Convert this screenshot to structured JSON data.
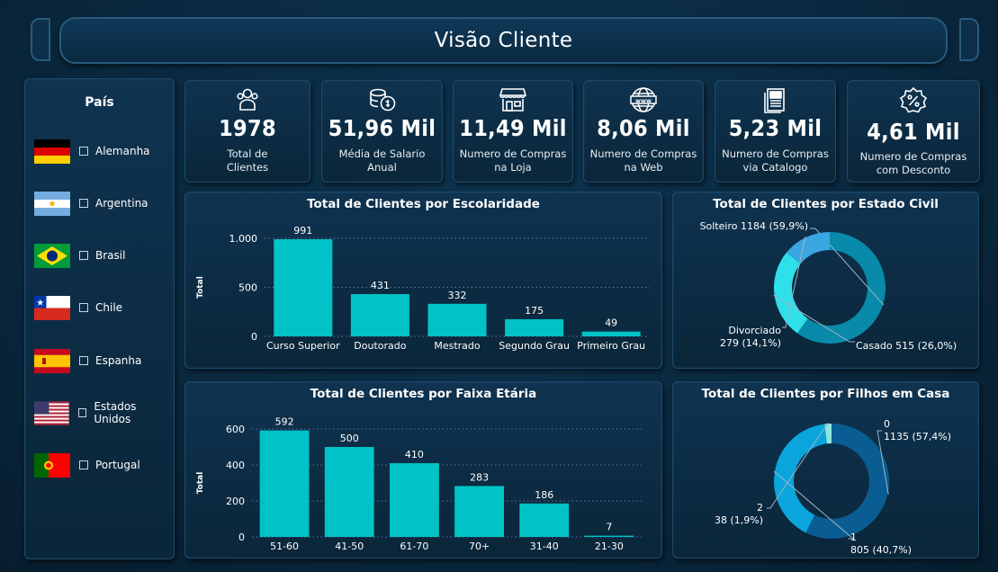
{
  "page": {
    "title": "Visão Cliente"
  },
  "country_filter": {
    "heading": "País",
    "items": [
      {
        "label": "Alemanha",
        "flag": "germany-flag"
      },
      {
        "label": "Argentina",
        "flag": "argentina-flag"
      },
      {
        "label": "Brasil",
        "flag": "brazil-flag"
      },
      {
        "label": "Chile",
        "flag": "chile-flag"
      },
      {
        "label": "Espanha",
        "flag": "spain-flag"
      },
      {
        "label": "Estados Unidos",
        "flag": "usa-flag"
      },
      {
        "label": "Portugal",
        "flag": "portugal-flag"
      }
    ]
  },
  "kpis": [
    {
      "value": "1978",
      "label_lines": [
        "Total de",
        "Clientes"
      ],
      "icon": "people-icon"
    },
    {
      "value": "51,96 Mil",
      "label_lines": [
        "Média de Salario",
        "Anual"
      ],
      "icon": "coins-icon"
    },
    {
      "value": "11,49 Mil",
      "label_lines": [
        "Numero de Compras",
        "na Loja"
      ],
      "icon": "store-icon"
    },
    {
      "value": "8,06 Mil",
      "label_lines": [
        "Numero de Compras",
        "na Web"
      ],
      "icon": "www-globe-icon"
    },
    {
      "value": "5,23 Mil",
      "label_lines": [
        "Numero de Compras",
        "via Catalogo"
      ],
      "icon": "catalog-icon"
    },
    {
      "value": "4,61 Mil",
      "label_lines": [
        "Numero de Compras",
        "com Desconto"
      ],
      "icon": "discount-badge-icon"
    }
  ],
  "colors": {
    "bar": "#00c2c7",
    "background": "#0a2940",
    "panel_border": "#1d4a6b",
    "grid": "#5b7a90"
  },
  "chart_data": [
    {
      "type": "bar",
      "title": "Total de Clientes por Escolaridade",
      "xlabel": "",
      "ylabel": "Total",
      "categories": [
        "Curso Superior",
        "Doutorado",
        "Mestrado",
        "Segundo Grau",
        "Primeiro Grau"
      ],
      "values": [
        991,
        431,
        332,
        175,
        49
      ],
      "yticks": [
        0,
        500,
        1000
      ],
      "ytick_labels": [
        "0",
        "500",
        "1.000"
      ],
      "ylim": [
        0,
        1000
      ],
      "grid": true,
      "color": "#00c2c7"
    },
    {
      "type": "pie",
      "title": "Total de Clientes por Estado Civil",
      "donut": true,
      "slices": [
        {
          "label": "Solteiro",
          "value": 1184,
          "percent": "59,9%",
          "color": "#0a8aaa",
          "text_lines": [
            "Solteiro 1184 (59,9%)"
          ]
        },
        {
          "label": "Casado",
          "value": 515,
          "percent": "26,0%",
          "color": "#2fe0ea",
          "text_lines": [
            "Casado 515 (26,0%)"
          ]
        },
        {
          "label": "Divorciado",
          "value": 279,
          "percent": "14,1%",
          "color": "#3aa6e2",
          "text_lines": [
            "Divorciado",
            "279 (14,1%)"
          ]
        }
      ]
    },
    {
      "type": "bar",
      "title": "Total de Clientes por Faixa Etária",
      "xlabel": "",
      "ylabel": "Total",
      "categories": [
        "51-60",
        "41-50",
        "61-70",
        "70+",
        "31-40",
        "21-30"
      ],
      "values": [
        592,
        500,
        410,
        283,
        186,
        7
      ],
      "yticks": [
        0,
        200,
        400,
        600
      ],
      "ytick_labels": [
        "0",
        "200",
        "400",
        "600"
      ],
      "ylim": [
        0,
        600
      ],
      "grid": true,
      "color": "#00c2c7"
    },
    {
      "type": "pie",
      "title": "Total de Clientes por Filhos em Casa",
      "donut": true,
      "slices": [
        {
          "label": "0",
          "value": 1135,
          "percent": "57,4%",
          "color": "#0a5d93",
          "text_lines": [
            "0",
            "1135 (57,4%)"
          ]
        },
        {
          "label": "1",
          "value": 805,
          "percent": "40,7%",
          "color": "#0aa5dc",
          "text_lines": [
            "1",
            "805 (40,7%)"
          ]
        },
        {
          "label": "2",
          "value": 38,
          "percent": "1,9%",
          "color": "#8fe6de",
          "text_lines": [
            "2",
            "38 (1,9%)"
          ]
        }
      ]
    }
  ]
}
